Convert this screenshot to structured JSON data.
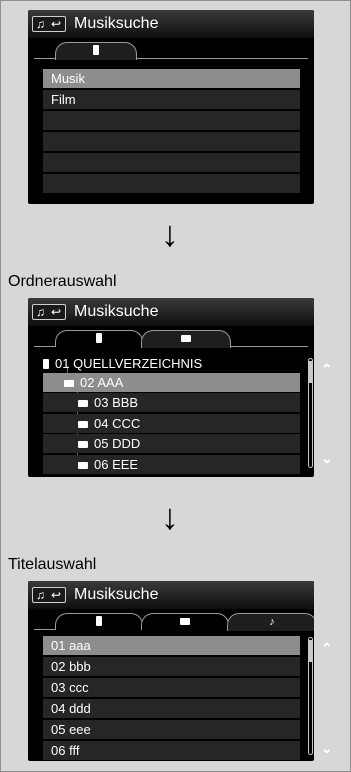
{
  "panel1": {
    "title": "Musiksuche",
    "items": [
      "Musik",
      "Film"
    ]
  },
  "panel2": {
    "caption": "Ordnerauswahl",
    "title": "Musiksuche",
    "root": "01 QUELLVERZEICHNIS",
    "selected": "02 AAA",
    "folders": [
      "03 BBB",
      "04 CCC",
      "05 DDD",
      "06 EEE"
    ]
  },
  "panel3": {
    "caption": "Titelauswahl",
    "title": "Musiksuche",
    "tracks": [
      "01 aaa",
      "02 bbb",
      "03 ccc",
      "04 ddd",
      "05 eee",
      "06 fff"
    ],
    "note_glyph": "♪"
  },
  "glyphs": {
    "down_arrow": "↓",
    "scroll_up": "⌃",
    "scroll_down": "⌄",
    "music_icon": "♫",
    "back_icon": "↩"
  }
}
